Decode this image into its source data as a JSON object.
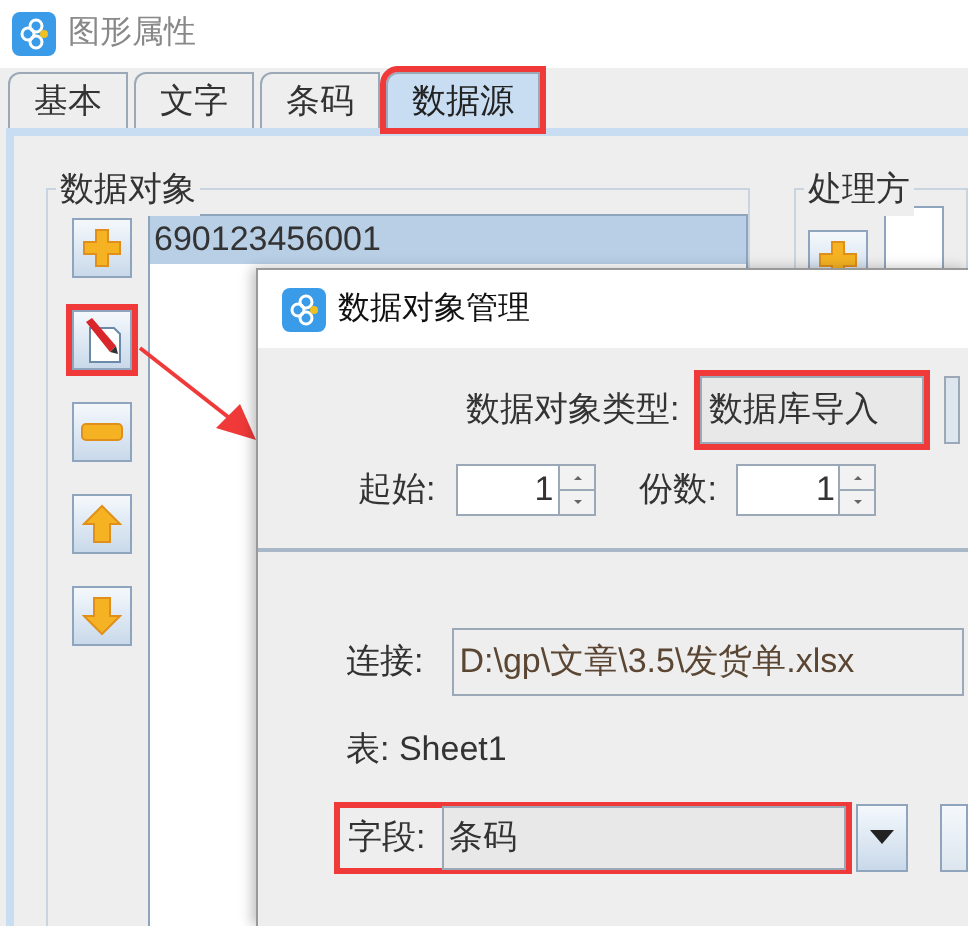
{
  "window": {
    "title": "图形属性"
  },
  "tabs": [
    {
      "label": "基本",
      "selected": false,
      "highlighted": false
    },
    {
      "label": "文字",
      "selected": false,
      "highlighted": false
    },
    {
      "label": "条码",
      "selected": false,
      "highlighted": false
    },
    {
      "label": "数据源",
      "selected": true,
      "highlighted": true
    }
  ],
  "data_objects": {
    "title": "数据对象",
    "toolbar": [
      {
        "kind": "add",
        "highlighted": false
      },
      {
        "kind": "edit",
        "highlighted": true
      },
      {
        "kind": "remove",
        "highlighted": false
      },
      {
        "kind": "up",
        "highlighted": false
      },
      {
        "kind": "down",
        "highlighted": false
      }
    ],
    "items": [
      {
        "text": "690123456001",
        "selected": true
      }
    ]
  },
  "processing": {
    "title": "处理方",
    "toolbar": [
      {
        "kind": "add"
      }
    ]
  },
  "dialog": {
    "title": "数据对象管理",
    "type_label": "数据对象类型:",
    "type_value": "数据库导入",
    "type_highlighted": true,
    "start_label": "起始:",
    "start_value": "1",
    "copies_label": "份数:",
    "copies_value": "1",
    "connection_label": "连接:",
    "connection_value": "D:\\gp\\文章\\3.5\\发货单.xlsx",
    "table_text": "表: Sheet1",
    "field_label": "字段:",
    "field_value": "条码",
    "field_highlighted": true
  }
}
